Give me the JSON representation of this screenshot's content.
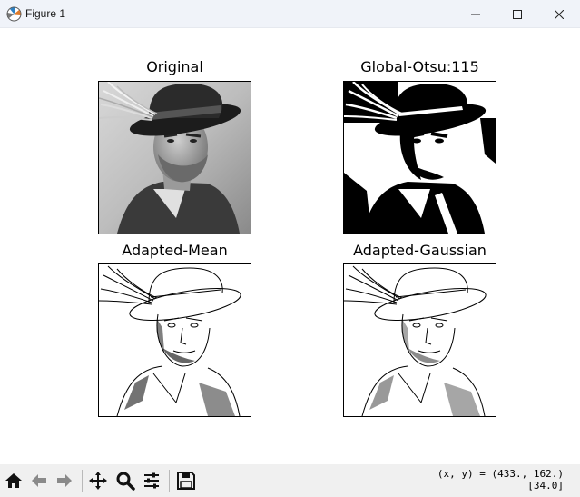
{
  "window": {
    "title": "Figure 1"
  },
  "subplots": [
    {
      "title": "Original"
    },
    {
      "title": "Global-Otsu:115"
    },
    {
      "title": "Adapted-Mean"
    },
    {
      "title": "Adapted-Gaussian"
    }
  ],
  "toolbar": {
    "items": [
      "home-icon",
      "back-icon",
      "forward-icon",
      "pan-icon",
      "zoom-icon",
      "configure-subplots-icon",
      "save-icon"
    ],
    "coords_line1": "(x, y) = (433., 162.)",
    "coords_line2": "[34.0]"
  },
  "colors": {
    "titlebar_bg": "#f0f3f9",
    "toolbar_bg": "#f0f0f0",
    "figure_bg": "#ffffff"
  }
}
